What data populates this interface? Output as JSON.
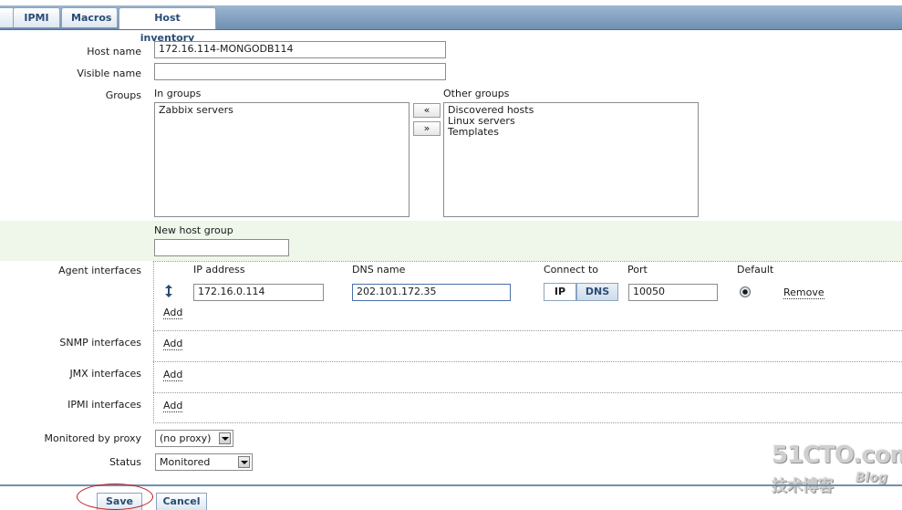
{
  "tabs": [
    "IPMI",
    "Macros",
    "Host inventory"
  ],
  "form": {
    "host_name_label": "Host name",
    "host_name_value": "172.16.114-MONGODB114",
    "visible_name_label": "Visible name",
    "visible_name_value": "",
    "groups_label": "Groups",
    "in_groups_label": "In groups",
    "other_groups_label": "Other groups",
    "in_groups": [
      "Zabbix servers"
    ],
    "other_groups": [
      "Discovered hosts",
      "Linux servers",
      "Templates"
    ],
    "move_left": "«",
    "move_right": "»",
    "new_host_group_label": "New host group",
    "new_host_group_value": ""
  },
  "interfaces": {
    "agent_label": "Agent interfaces",
    "snmp_label": "SNMP interfaces",
    "jmx_label": "JMX interfaces",
    "ipmi_label": "IPMI interfaces",
    "col_ip": "IP address",
    "col_dns": "DNS name",
    "col_connect": "Connect to",
    "col_port": "Port",
    "col_default": "Default",
    "row": {
      "ip": "172.16.0.114",
      "dns": "202.101.172.35",
      "connect_ip": "IP",
      "connect_dns": "DNS",
      "port": "10050",
      "remove": "Remove"
    },
    "add_label": "Add"
  },
  "proxy": {
    "label": "Monitored by proxy",
    "value": "(no proxy)"
  },
  "status": {
    "label": "Status",
    "value": "Monitored"
  },
  "buttons": {
    "save": "Save",
    "cancel": "Cancel"
  },
  "watermark": {
    "line1": "51CTO.com",
    "line2": "技术博客",
    "line3": "Blog"
  },
  "colors": {
    "tab_text": "#2b4c74",
    "accent": "#6f90b3",
    "highlight_row": "#eef7ea",
    "save_circle": "#c01818"
  },
  "icons": {
    "drag": "updown-arrow-icon",
    "dropdown": "chevron-down-icon"
  }
}
